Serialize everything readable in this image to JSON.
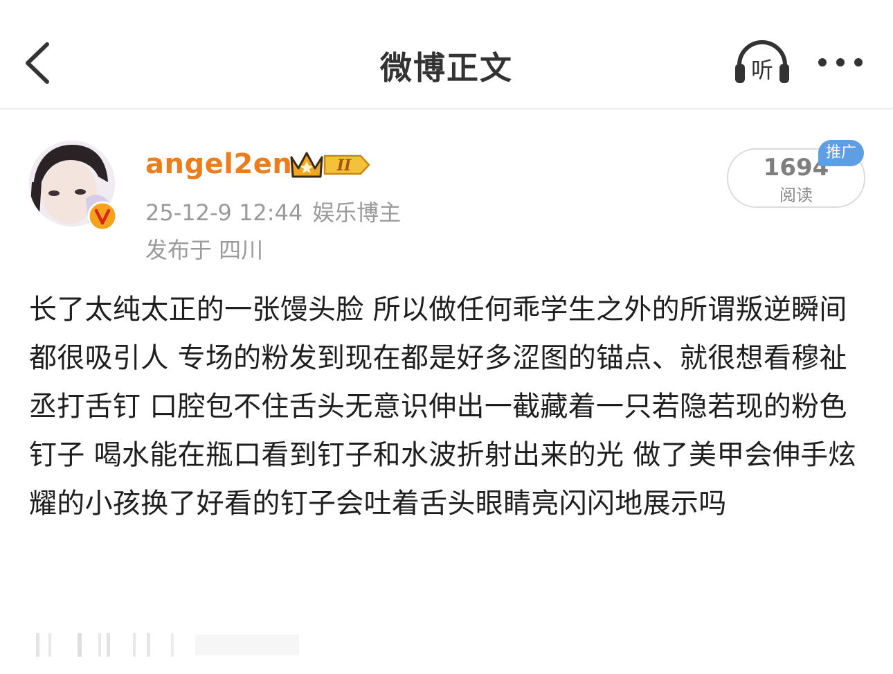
{
  "nav": {
    "title": "微博正文",
    "back_icon": "chevron-left-icon",
    "listen_icon": "headphones-icon",
    "listen_label": "听",
    "more_icon": "ellipsis-icon"
  },
  "post": {
    "author": {
      "name": "angel2en",
      "avatar": "avatar-image",
      "verified_icon": "verified-v-icon",
      "vip_icon": "vip-crown-icon",
      "vip_level": "II"
    },
    "time": "25-12-9 12:44",
    "category": "娱乐博主",
    "location": "发布于 四川",
    "reads": {
      "count": "1694",
      "label": "阅读"
    },
    "promo_badge": "推广",
    "body": "长了太纯太正的一张馒头脸 所以做任何乖学生之外的所谓叛逆瞬间都很吸引人 专场的粉发到现在都是好多涩图的锚点、就很想看穆祉丞打舌钉 口腔包不住舌头无意识伸出一截藏着一只若隐若现的粉色钉子 喝水能在瓶口看到钉子和水波折射出来的光 做了美甲会伸手炫耀的小孩换了好看的钉子会吐着舌头眼睛亮闪闪地展示吗"
  },
  "colors": {
    "username": "#ea7e1f",
    "meta": "#9a9a9a",
    "promo_badge": "#5d9fe2",
    "crown": "#f0a623",
    "verified": "#f5a31a"
  }
}
